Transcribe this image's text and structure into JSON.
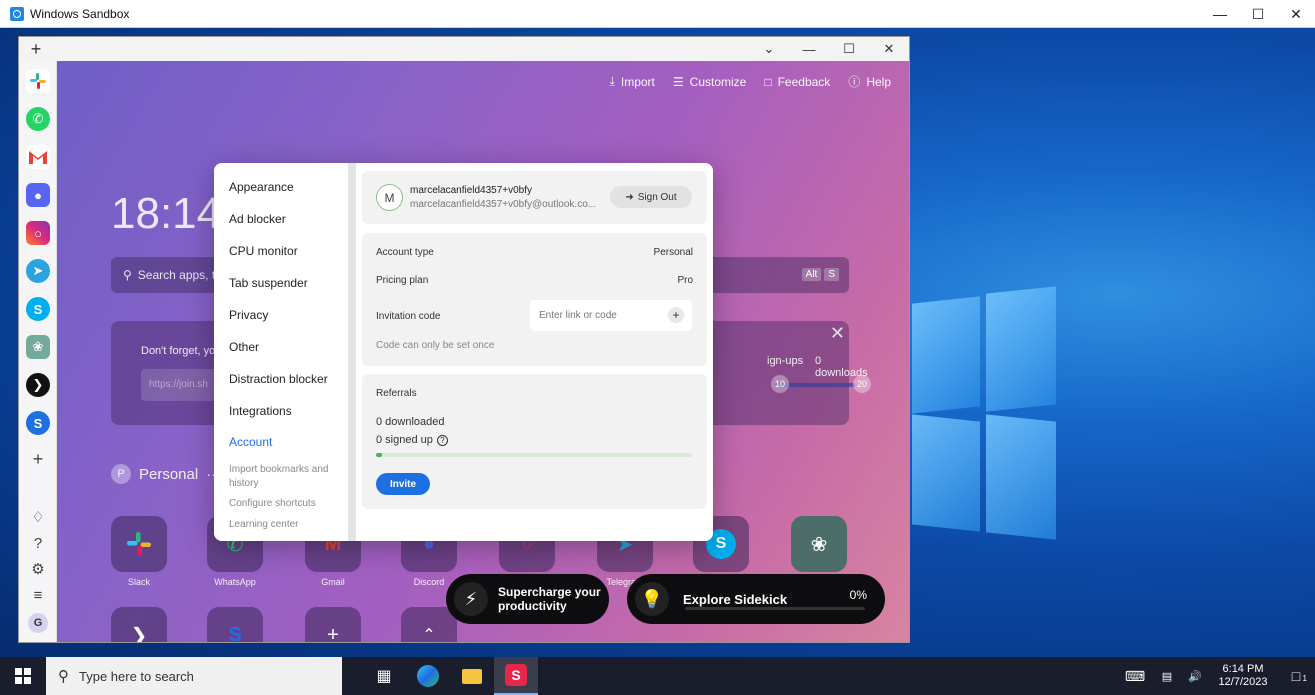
{
  "sandbox": {
    "title": "Windows Sandbox"
  },
  "shift": {
    "topbar": {
      "import": "Import",
      "customize": "Customize",
      "feedback": "Feedback",
      "help": "Help"
    },
    "clock": "18:14",
    "search_placeholder": "Search apps, t",
    "shortcut_keys": [
      "Alt",
      "S"
    ],
    "banner": {
      "text": "Don't forget, yo",
      "input_value": "https://join.sh",
      "signups": "ign-ups",
      "downloads": "0 downloads",
      "m1": "10",
      "m2": "20"
    },
    "personal": {
      "avatar": "P",
      "label": "Personal"
    },
    "apps": [
      "Slack",
      "WhatsApp",
      "Gmail",
      "Discord",
      "Instagram",
      "Telegram",
      "Skype",
      "ChatGPT"
    ],
    "pills": {
      "supercharge": "Supercharge your productivity",
      "sidekick": "Explore Sidekick",
      "sidekick_pct": "0%"
    },
    "sidebar_user": "G"
  },
  "settings": {
    "nav": [
      "Appearance",
      "Ad blocker",
      "CPU monitor",
      "Tab suspender",
      "Privacy",
      "Other",
      "Distraction blocker",
      "Integrations",
      "Account"
    ],
    "nav_sub": [
      "Import bookmarks and history",
      "Configure shortcuts",
      "Learning center"
    ],
    "account": {
      "avatar": "M",
      "name": "marcelacanfield4357+v0bfy",
      "email": "marcelacanfield4357+v0bfy@outlook.co...",
      "sign_out": "Sign Out",
      "account_type_label": "Account type",
      "account_type_value": "Personal",
      "pricing_label": "Pricing plan",
      "pricing_value": "Pro",
      "invitation_label": "Invitation code",
      "invitation_placeholder": "Enter link or code",
      "invitation_note": "Code can only be set once",
      "referrals_title": "Referrals",
      "downloaded": "0 downloaded",
      "signed_up": "0 signed up",
      "invite": "Invite",
      "progress": 0.02
    }
  },
  "taskbar": {
    "search_placeholder": "Type here to search",
    "time": "6:14 PM",
    "date": "12/7/2023",
    "notifications": "1"
  },
  "colors": {
    "accent": "#1e6fe0",
    "slack": "#4a154b",
    "whatsapp": "#25d366",
    "gmail": "#ea4335",
    "discord": "#5865f2",
    "instagram": "#e1306c",
    "telegram": "#2aa3e0",
    "skype": "#00aff0",
    "chatgpt": "#74aa9c"
  }
}
